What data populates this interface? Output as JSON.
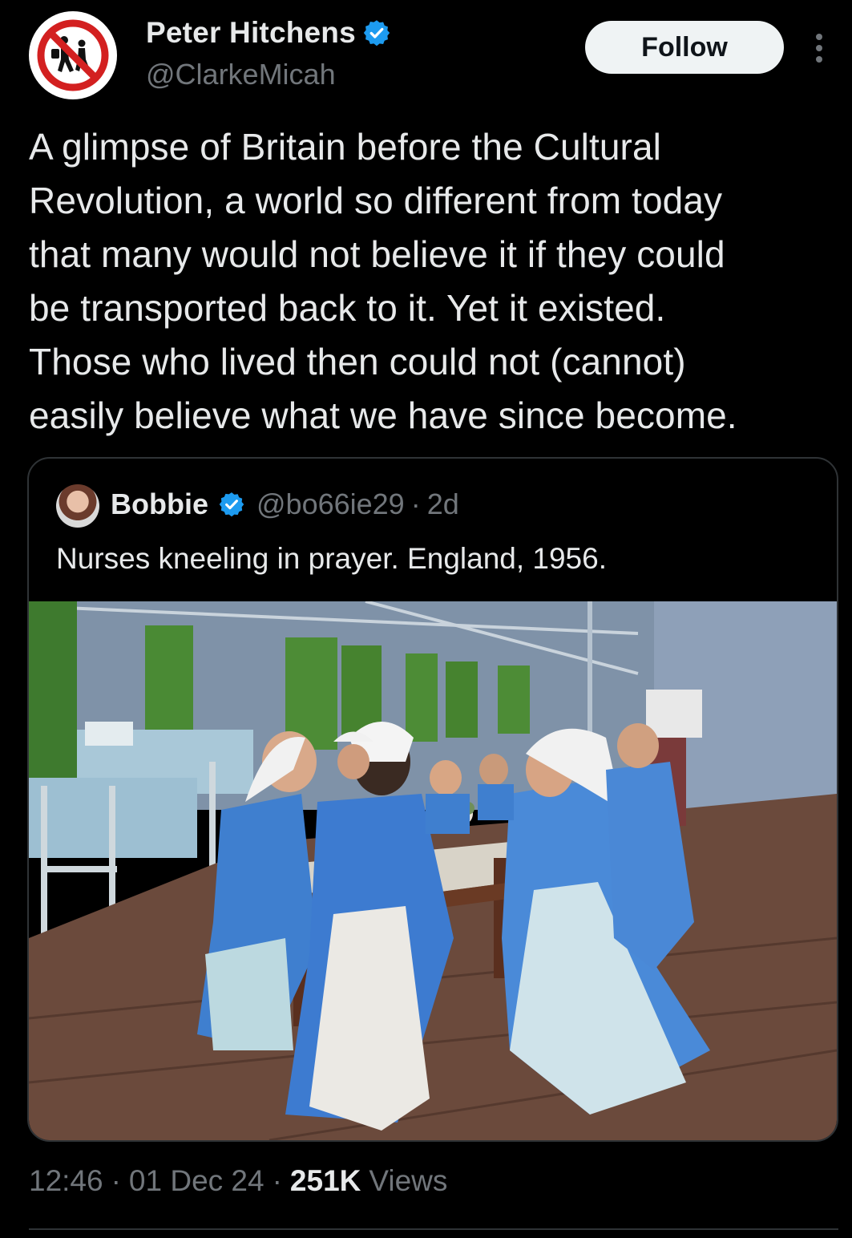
{
  "author": {
    "display_name": "Peter Hitchens",
    "handle": "@ClarkeMicah",
    "avatar_icon": "no-children-crossing-sign-icon",
    "verified": true
  },
  "actions": {
    "follow_label": "Follow",
    "more_icon": "more-vertical-icon"
  },
  "tweet": {
    "text": "A glimpse of Britain before the Cultural\nRevolution, a world so different from today\nthat many would not believe it if they could\nbe transported back to it. Yet it existed.\nThose who lived then could not (cannot)\neasily believe what we have since become."
  },
  "quote": {
    "display_name": "Bobbie",
    "handle": "@bo66ie29",
    "separator": "·",
    "age": "2d",
    "verified": true,
    "text": "Nurses kneeling in prayer. England, 1956."
  },
  "meta": {
    "time": "12:46",
    "separator": "·",
    "date": "01 Dec 24",
    "views_count": "251K",
    "views_label": "Views"
  },
  "colors": {
    "background": "#000000",
    "text": "#e7e9ea",
    "secondary_text": "#71767b",
    "verified_blue": "#1d9bf0",
    "border": "#2f3336"
  }
}
